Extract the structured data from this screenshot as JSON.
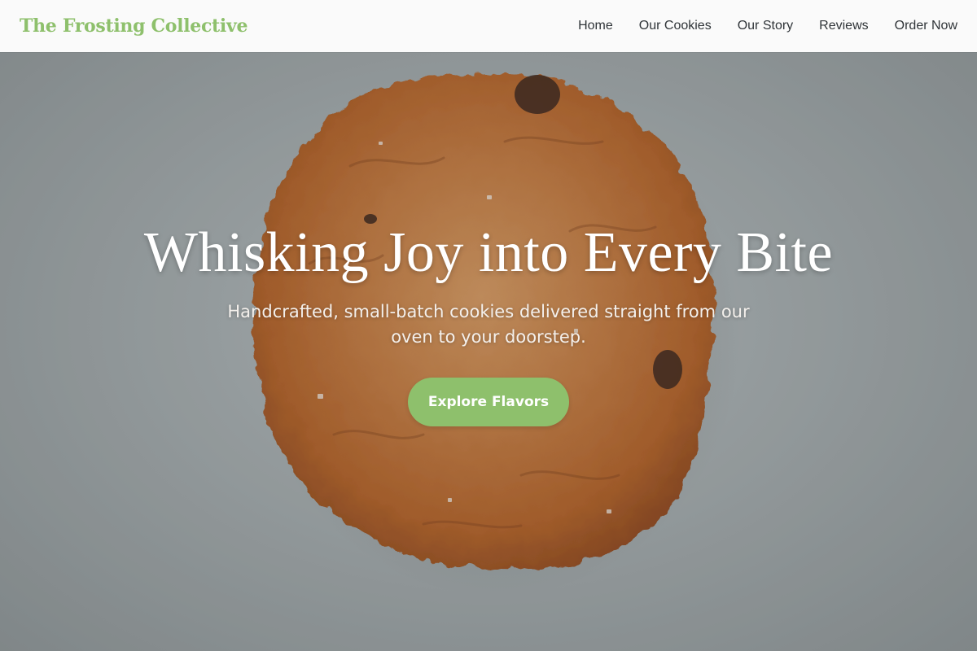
{
  "brand": {
    "name": "The Frosting Collective",
    "color": "#8ec06c"
  },
  "nav": {
    "items": [
      {
        "label": "Home"
      },
      {
        "label": "Our Cookies"
      },
      {
        "label": "Our Story"
      },
      {
        "label": "Reviews"
      },
      {
        "label": "Order Now"
      }
    ]
  },
  "hero": {
    "title": "Whisking Joy into Every Bite",
    "subtitle": "Handcrafted, small-batch cookies delivered straight from our oven to your doorstep.",
    "cta_label": "Explore Flavors",
    "cta_color": "#8ec06c",
    "image_subject": "cookie-photo"
  }
}
